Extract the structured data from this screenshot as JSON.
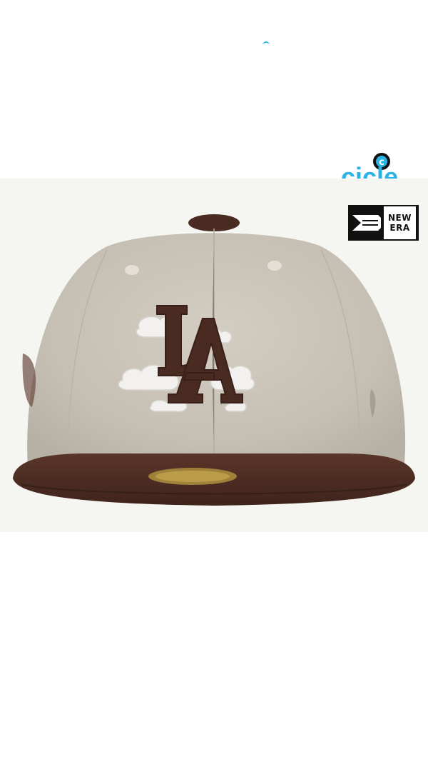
{
  "brand_logo": {
    "name": "cicle-logo",
    "text": "cicle"
  },
  "photo": {
    "subject": "cap",
    "logo_text": "LA"
  },
  "newera_logo": {
    "line1": "NEW",
    "line2": "ERA"
  },
  "colors": {
    "accent": "#2bb3e6",
    "crown": "#c9c3b7",
    "brim": "#4a2b22",
    "embroidery": "#4a2b22",
    "background": "#f5f5f1"
  }
}
